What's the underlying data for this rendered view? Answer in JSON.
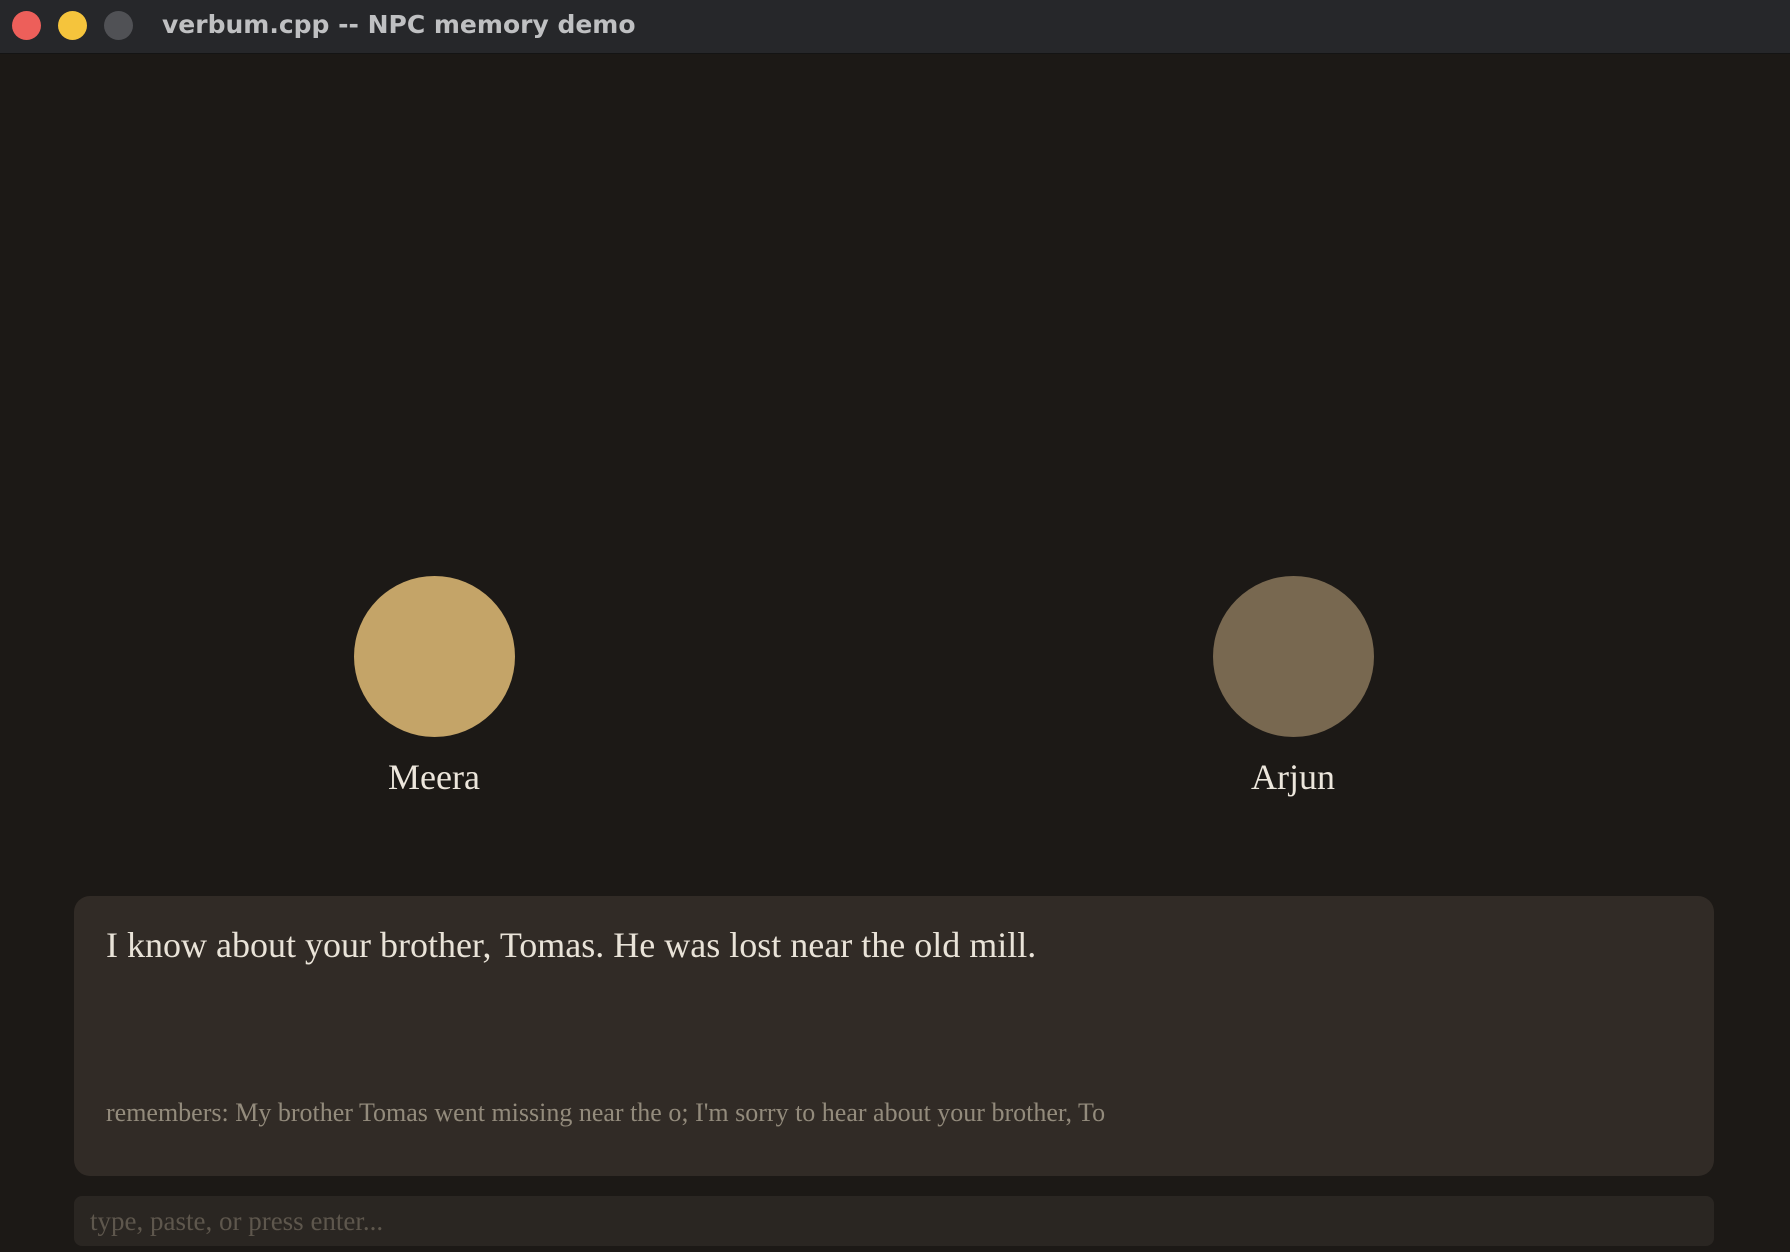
{
  "window": {
    "title": "verbum.cpp -- NPC memory demo"
  },
  "npcs": [
    {
      "name": "Meera",
      "color": "#c4a468",
      "active": true
    },
    {
      "name": "Arjun",
      "color": "#786850",
      "active": false
    }
  ],
  "dialogue": {
    "text": "I know about your brother, Tomas. He was lost near the old mill.",
    "memory": "remembers: My brother Tomas went missing near the o; I'm sorry to hear about your brother, To"
  },
  "input": {
    "placeholder": "type, paste, or press enter...",
    "value": ""
  }
}
